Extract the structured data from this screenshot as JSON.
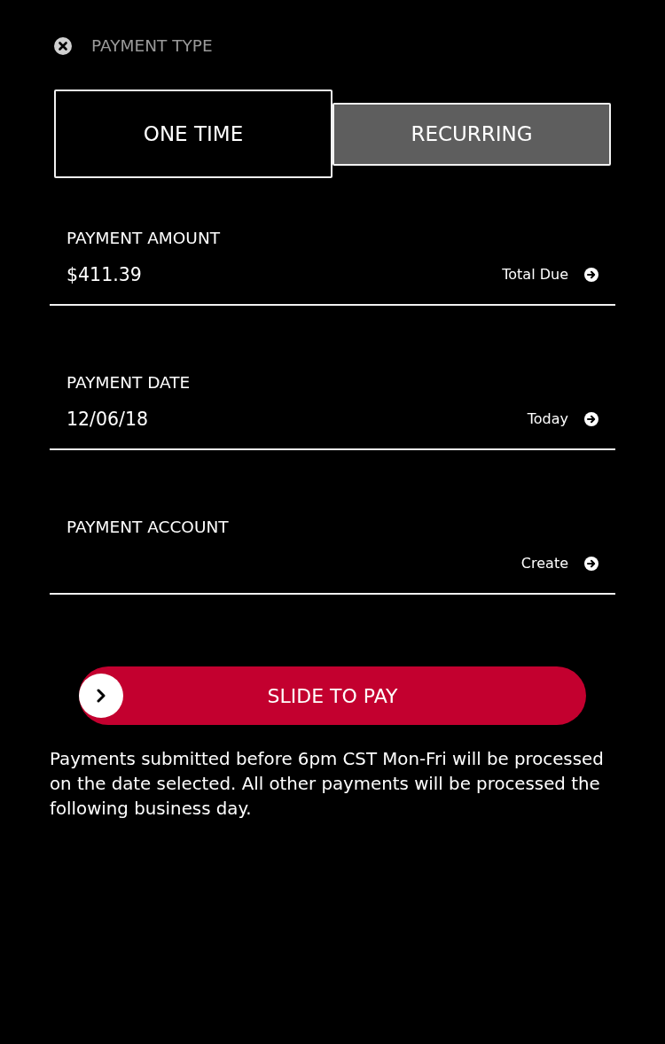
{
  "header": {
    "title": "PAYMENT TYPE"
  },
  "tabs": [
    {
      "label": "ONE TIME",
      "selected": true
    },
    {
      "label": "RECURRING",
      "selected": false
    }
  ],
  "fields": [
    {
      "label": "PAYMENT AMOUNT",
      "value": "$411.39",
      "action": "Total Due"
    },
    {
      "label": "PAYMENT DATE",
      "value": "12/06/18",
      "action": "Today"
    },
    {
      "label": "PAYMENT ACCOUNT",
      "action": "Create"
    }
  ],
  "slide_button": {
    "label": "SLIDE TO PAY"
  },
  "note": "Payments submitted before 6pm CST Mon-Fri will be processed on the date selected. All other payments will be processed the following business day."
}
